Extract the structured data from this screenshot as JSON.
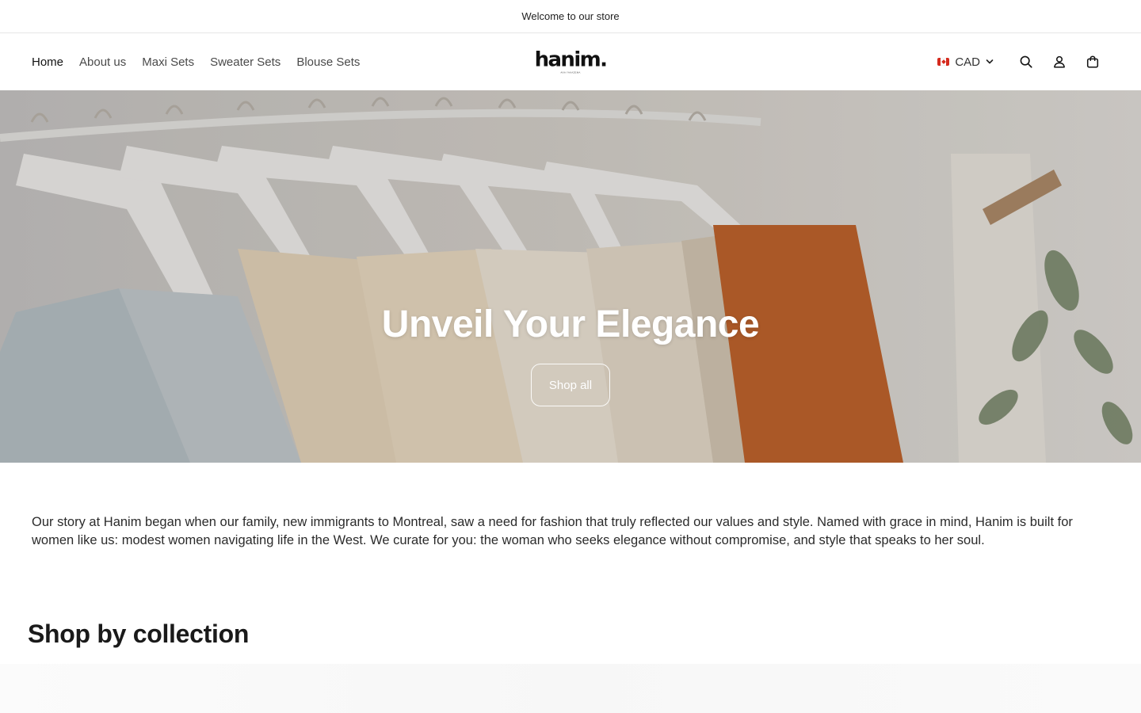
{
  "announcement": {
    "text": "Welcome to our store"
  },
  "nav": {
    "items": [
      {
        "label": "Home",
        "active": true
      },
      {
        "label": "About us"
      },
      {
        "label": "Maxi Sets"
      },
      {
        "label": "Sweater Sets"
      },
      {
        "label": "Blouse Sets"
      }
    ]
  },
  "logo": {
    "text": "hanim.",
    "tagline": "ANA YAKAZEMA"
  },
  "header": {
    "currency": "CAD",
    "currency_flag": "canada-flag-icon"
  },
  "hero": {
    "title": "Unveil Your Elegance",
    "button_label": "Shop all"
  },
  "story": {
    "text": "Our story at Hanim began when our family, new immigrants to Montreal, saw a need for fashion that truly reflected our values and style. Named with grace in mind, Hanim is built for women like us: modest women navigating life in the West. We curate for you: the woman who seeks elegance without compromise, and style that speaks to her soul."
  },
  "collections": {
    "heading": "Shop by collection"
  },
  "colors": {
    "accent": "#121212",
    "hero_overlay": "#000000",
    "flag_red": "#d52b1e"
  }
}
